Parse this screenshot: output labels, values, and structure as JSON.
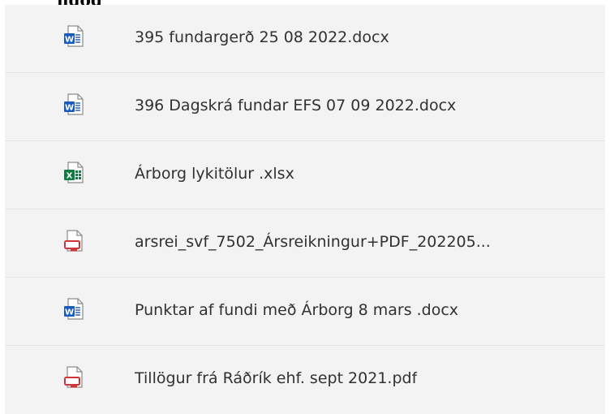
{
  "header": {
    "partial_title": "ngog"
  },
  "files": [
    {
      "name": "395 fundargerð 25 08 2022.docx",
      "type": "word",
      "icon": "word-file-icon"
    },
    {
      "name": "396 Dagskrá fundar EFS 07 09 2022.docx",
      "type": "word",
      "icon": "word-file-icon"
    },
    {
      "name": "Árborg lykitölur .xlsx",
      "type": "excel",
      "icon": "excel-file-icon"
    },
    {
      "name": "arsrei_svf_7502_Ársreikningur+PDF_202205...",
      "type": "pdf",
      "icon": "pdf-file-icon"
    },
    {
      "name": "Punktar af fundi með Árborg 8 mars .docx",
      "type": "word",
      "icon": "word-file-icon"
    },
    {
      "name": "Tillögur frá Ráðrík ehf. sept 2021.pdf",
      "type": "pdf",
      "icon": "pdf-file-icon"
    }
  ],
  "colors": {
    "word": "#185abd",
    "excel": "#107c41",
    "pdf": "#d13438",
    "panel_bg": "#f3f3f3",
    "text": "#323130"
  }
}
